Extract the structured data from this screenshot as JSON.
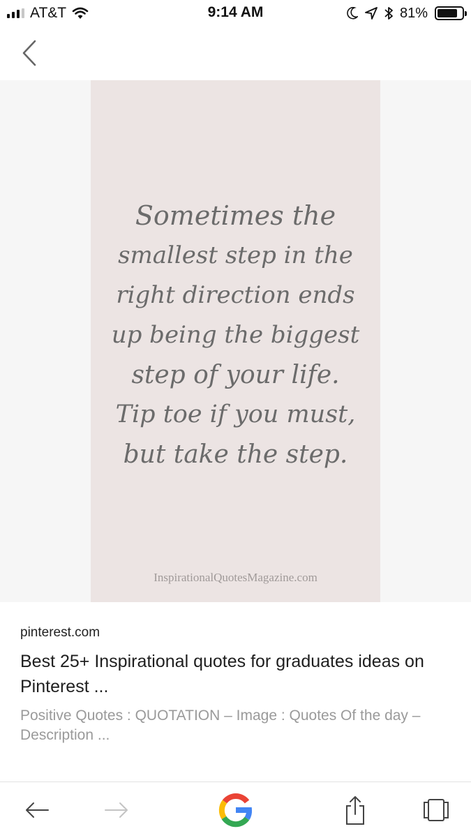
{
  "status_bar": {
    "carrier": "AT&T",
    "time": "9:14 AM",
    "battery_percent": "81%",
    "battery_level": 0.81,
    "icons": [
      "signal-icon",
      "wifi-icon",
      "moon-icon",
      "location-arrow-icon",
      "bluetooth-icon",
      "battery-icon"
    ]
  },
  "header": {
    "back_icon": "chevron-left-icon"
  },
  "image": {
    "quote_lines": [
      "Sometimes the",
      "smallest step in the",
      "right direction ends",
      "up being the biggest",
      "step of your life.",
      "Tip toe if you must,",
      "but take the step."
    ],
    "watermark": "InspirationalQuotesMagazine.com",
    "card_color": "#ece4e3"
  },
  "result": {
    "domain": "pinterest.com",
    "title": "Best 25+ Inspirational quotes for graduates ideas on Pinterest ...",
    "description": "Positive Quotes : QUOTATION – Image : Quotes Of the day – Description ..."
  },
  "toolbar": {
    "items": [
      "back-arrow-icon",
      "forward-arrow-icon",
      "google-logo-icon",
      "share-icon",
      "tabs-icon"
    ],
    "google_colors": [
      "#4285F4",
      "#EA4335",
      "#FBBC05",
      "#34A853"
    ]
  }
}
